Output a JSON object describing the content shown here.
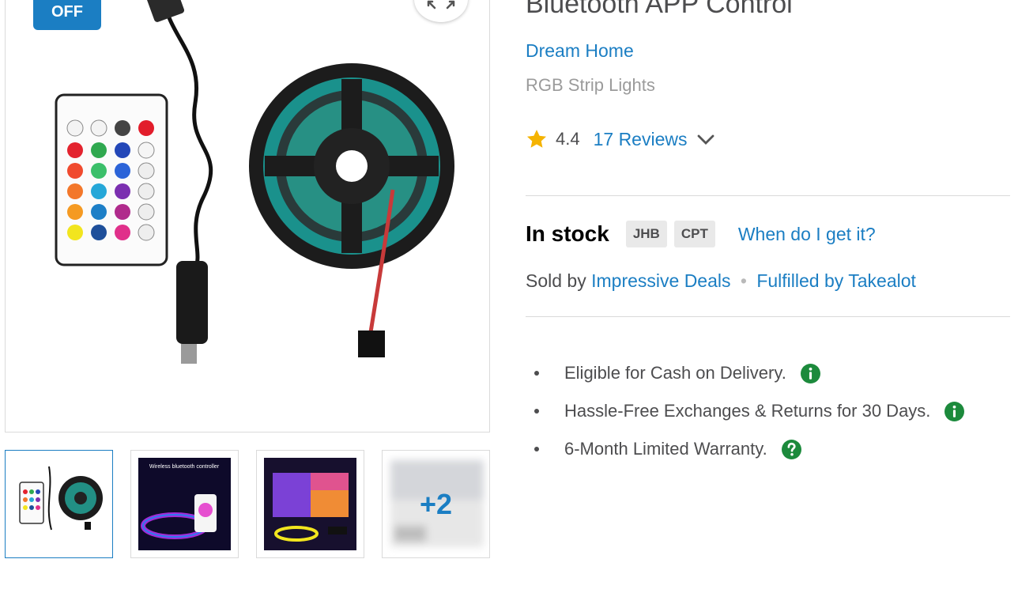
{
  "badge": {
    "discount_label": "OFF"
  },
  "product": {
    "title": "Bluetooth APP Control",
    "brand": "Dream Home",
    "category": "RGB Strip Lights"
  },
  "rating": {
    "value": "4.4",
    "reviews_label": "17 Reviews"
  },
  "stock": {
    "status": "In stock",
    "warehouses": [
      "JHB",
      "CPT"
    ],
    "when_label": "When do I get it?"
  },
  "seller": {
    "sold_by_prefix": "Sold by",
    "seller_name": "Impressive Deals",
    "separator": "•",
    "fulfilled_label": "Fulfilled by Takealot"
  },
  "benefits": [
    {
      "text": "Eligible for Cash on Delivery.",
      "icon": "info-icon"
    },
    {
      "text": "Hassle-Free Exchanges & Returns for 30 Days.",
      "icon": "info-icon"
    },
    {
      "text": "6-Month Limited Warranty.",
      "icon": "help-icon"
    }
  ],
  "thumbnails": {
    "more_label": "+2"
  },
  "colors": {
    "accent": "#1b7ec3",
    "star": "#f5b301",
    "info_green": "#1c8a3c",
    "text": "#4d4d4f"
  }
}
